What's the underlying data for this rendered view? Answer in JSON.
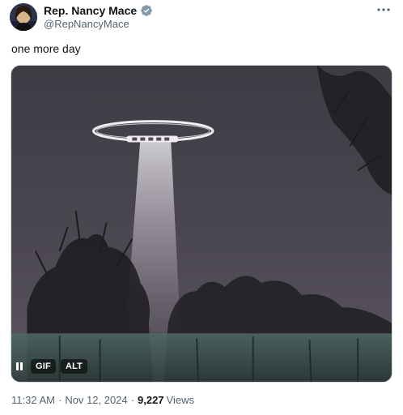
{
  "author": {
    "display_name": "Rep. Nancy Mace",
    "handle": "@RepNancyMace",
    "verified_color": "#829aab"
  },
  "tweet": {
    "text": "one more day"
  },
  "media": {
    "pause_icon": "pause-icon",
    "gif_label": "GIF",
    "alt_label": "ALT"
  },
  "meta": {
    "time": "11:32 AM",
    "separator": "·",
    "date": "Nov 12, 2024",
    "views_count": "9,227",
    "views_label": "Views"
  },
  "icons": {
    "more": "more-options-icon",
    "verified": "verified-badge-icon"
  }
}
